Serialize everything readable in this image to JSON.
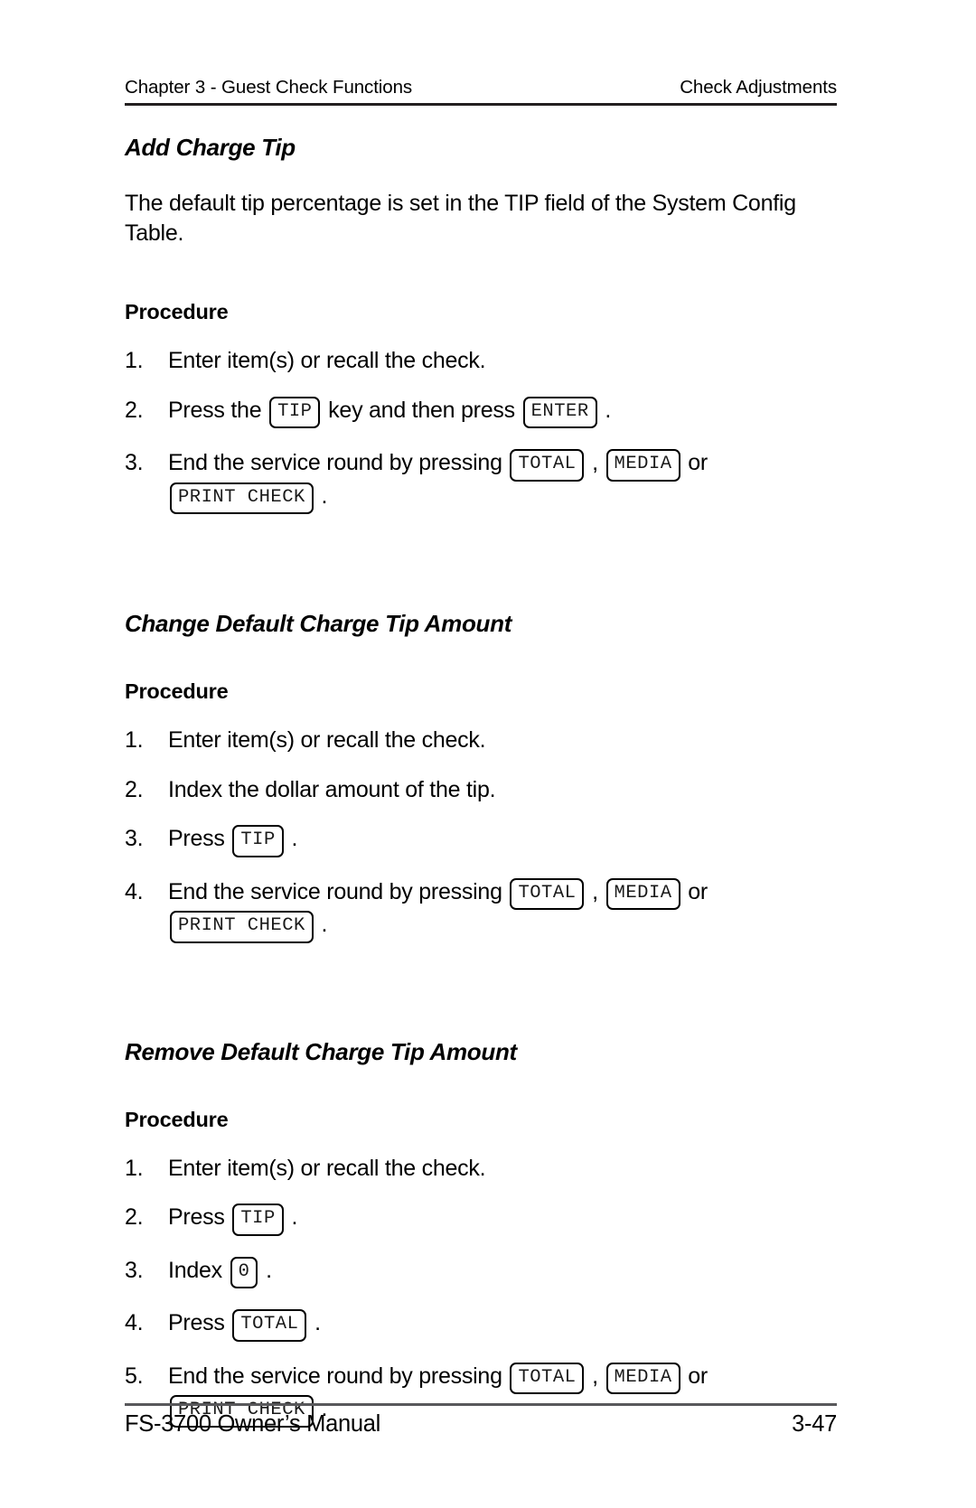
{
  "header": {
    "left": "Chapter 3 - Guest Check Functions",
    "right": "Check Adjustments"
  },
  "footer": {
    "left": "FS-3700 Owner’s Manual",
    "right": "3-47"
  },
  "sections": [
    {
      "title": "Add Charge Tip",
      "intro": "The default tip percentage is set in the TIP field of the System Config Table.",
      "procedure_label": "Procedure",
      "steps": [
        {
          "num": "1.",
          "parts": [
            {
              "t": "text",
              "v": "Enter item(s) or recall the check."
            }
          ]
        },
        {
          "num": "2.",
          "parts": [
            {
              "t": "text",
              "v": "Press the "
            },
            {
              "t": "key",
              "v": "TIP"
            },
            {
              "t": "text",
              "v": " key and then press "
            },
            {
              "t": "key",
              "v": "ENTER"
            },
            {
              "t": "text",
              "v": " ."
            }
          ]
        },
        {
          "num": "3.",
          "parts": [
            {
              "t": "text",
              "v": "End the service round by pressing "
            },
            {
              "t": "key",
              "v": "TOTAL"
            },
            {
              "t": "text",
              "v": " , "
            },
            {
              "t": "key",
              "v": "MEDIA"
            },
            {
              "t": "text",
              "v": " or "
            },
            {
              "t": "break"
            },
            {
              "t": "key",
              "v": "PRINT CHECK"
            },
            {
              "t": "text",
              "v": " ."
            }
          ]
        }
      ]
    },
    {
      "title": "Change Default Charge Tip Amount",
      "intro": "",
      "procedure_label": "Procedure",
      "steps": [
        {
          "num": "1.",
          "parts": [
            {
              "t": "text",
              "v": "Enter item(s) or recall the check."
            }
          ]
        },
        {
          "num": "2.",
          "parts": [
            {
              "t": "text",
              "v": "Index the dollar amount of the tip."
            }
          ]
        },
        {
          "num": "3.",
          "parts": [
            {
              "t": "text",
              "v": "Press "
            },
            {
              "t": "key",
              "v": "TIP"
            },
            {
              "t": "text",
              "v": " ."
            }
          ]
        },
        {
          "num": "4.",
          "parts": [
            {
              "t": "text",
              "v": "End the service round by pressing "
            },
            {
              "t": "key",
              "v": "TOTAL"
            },
            {
              "t": "text",
              "v": " , "
            },
            {
              "t": "key",
              "v": "MEDIA"
            },
            {
              "t": "text",
              "v": " or "
            },
            {
              "t": "break"
            },
            {
              "t": "key",
              "v": "PRINT CHECK"
            },
            {
              "t": "text",
              "v": " ."
            }
          ]
        }
      ]
    },
    {
      "title": "Remove Default Charge Tip Amount",
      "intro": "",
      "procedure_label": "Procedure",
      "steps": [
        {
          "num": "1.",
          "parts": [
            {
              "t": "text",
              "v": "Enter item(s) or recall the check."
            }
          ]
        },
        {
          "num": "2.",
          "parts": [
            {
              "t": "text",
              "v": "Press "
            },
            {
              "t": "key",
              "v": "TIP"
            },
            {
              "t": "text",
              "v": " ."
            }
          ]
        },
        {
          "num": "3.",
          "parts": [
            {
              "t": "text",
              "v": "Index "
            },
            {
              "t": "key",
              "v": "0"
            },
            {
              "t": "text",
              "v": " ."
            }
          ]
        },
        {
          "num": "4.",
          "parts": [
            {
              "t": "text",
              "v": "Press "
            },
            {
              "t": "key",
              "v": "TOTAL"
            },
            {
              "t": "text",
              "v": " ."
            }
          ]
        },
        {
          "num": "5.",
          "parts": [
            {
              "t": "text",
              "v": "End the service round by pressing "
            },
            {
              "t": "key",
              "v": "TOTAL"
            },
            {
              "t": "text",
              "v": " , "
            },
            {
              "t": "key",
              "v": "MEDIA"
            },
            {
              "t": "text",
              "v": " or "
            },
            {
              "t": "break"
            },
            {
              "t": "key",
              "v": "PRINT CHECK"
            },
            {
              "t": "text",
              "v": " ."
            }
          ]
        }
      ]
    }
  ]
}
